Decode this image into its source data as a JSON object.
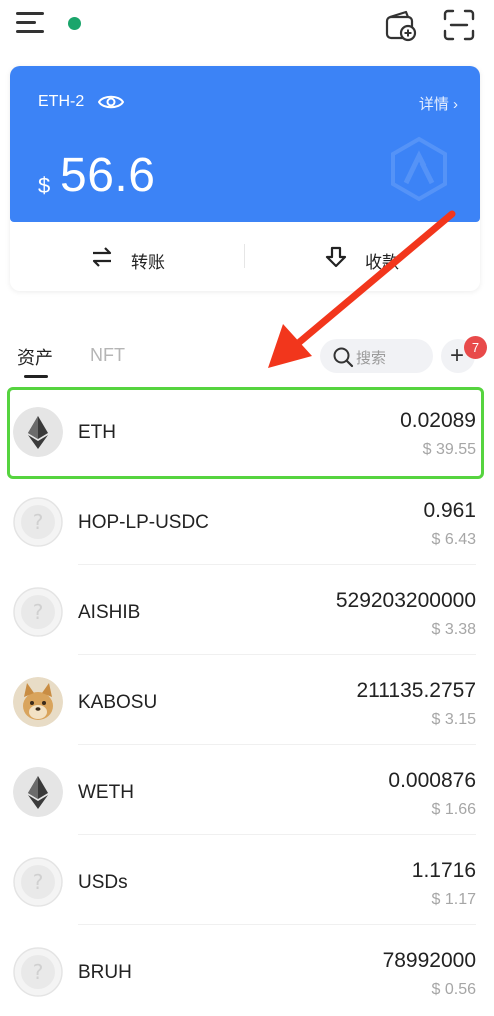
{
  "header": {
    "menu_icon": "hamburger-menu-icon",
    "status_color": "#1aa56b",
    "wallet_add_icon": "wallet-add-icon",
    "scan_icon": "scan-icon"
  },
  "wallet_card": {
    "name": "ETH-2",
    "visibility_icon": "eye-icon",
    "detail_label": "详情 ›",
    "currency_symbol": "$",
    "balance": "56.6",
    "accent_color": "#3c83f6",
    "transfer_label": "转账",
    "receive_label": "收款"
  },
  "tabs": {
    "assets_label": "资产",
    "nft_label": "NFT",
    "search_placeholder": "搜索",
    "add_badge_count": "7"
  },
  "tokens": [
    {
      "name": "ETH",
      "amount": "0.02089",
      "value": "$ 39.55",
      "icon": "ethereum-icon",
      "highlighted": true
    },
    {
      "name": "HOP-LP-USDC",
      "amount": "0.961",
      "value": "$ 6.43",
      "icon": "unknown-token-icon"
    },
    {
      "name": "AISHIB",
      "amount": "529203200000",
      "value": "$ 3.38",
      "icon": "unknown-token-icon"
    },
    {
      "name": "KABOSU",
      "amount": "211135.2757",
      "value": "$ 3.15",
      "icon": "kabosu-dog-icon"
    },
    {
      "name": "WETH",
      "amount": "0.000876",
      "value": "$ 1.66",
      "icon": "ethereum-icon"
    },
    {
      "name": "USDs",
      "amount": "1.1716",
      "value": "$ 1.17",
      "icon": "unknown-token-icon"
    },
    {
      "name": "BRUH",
      "amount": "78992000",
      "value": "$ 0.56",
      "icon": "unknown-token-icon"
    }
  ],
  "colors": {
    "highlight_border": "#56d43f",
    "annotation_arrow": "#f2361c",
    "badge": "#e84a4a"
  }
}
